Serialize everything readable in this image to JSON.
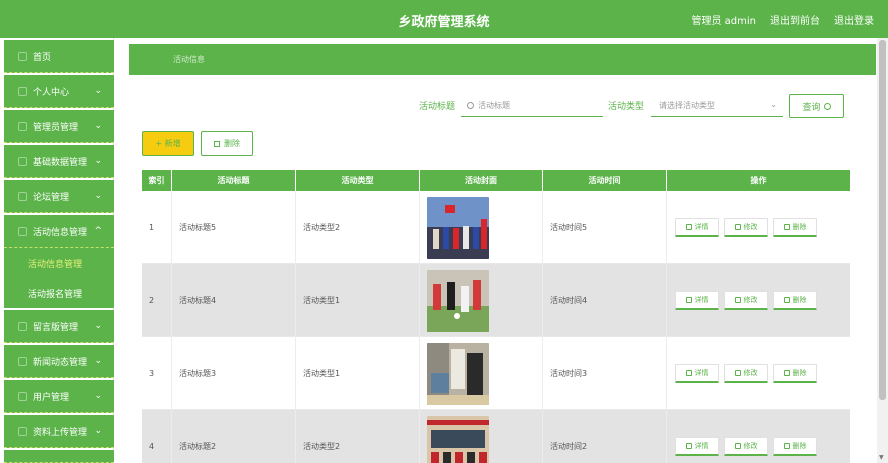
{
  "header": {
    "title": "乡政府管理系统",
    "user_label": "管理员 admin",
    "to_front": "退出到前台",
    "logout": "退出登录"
  },
  "sidebar": {
    "items": [
      {
        "label": "首页"
      },
      {
        "label": "个人中心"
      },
      {
        "label": "管理员管理"
      },
      {
        "label": "基础数据管理"
      },
      {
        "label": "论坛管理"
      },
      {
        "label": "活动信息管理"
      },
      {
        "label": "活动信息管理"
      },
      {
        "label": "活动报名管理"
      },
      {
        "label": "留言版管理"
      },
      {
        "label": "新闻动态管理"
      },
      {
        "label": "用户管理"
      },
      {
        "label": "资料上传管理"
      }
    ]
  },
  "breadcrumb": {
    "current": "活动信息"
  },
  "search": {
    "title_label": "活动标题",
    "title_placeholder": "活动标题",
    "type_label": "活动类型",
    "type_placeholder": "请选择活动类型",
    "query_label": "查询"
  },
  "actions": {
    "add_label": "+ 新增",
    "delete_label": "删除"
  },
  "table": {
    "columns": [
      "索引",
      "活动标题",
      "活动类型",
      "活动封面",
      "活动时间",
      "操作"
    ],
    "rows": [
      {
        "index": "1",
        "title": "活动标题5",
        "type": "活动类型2",
        "time": "活动时间5"
      },
      {
        "index": "2",
        "title": "活动标题4",
        "type": "活动类型1",
        "time": "活动时间4"
      },
      {
        "index": "3",
        "title": "活动标题3",
        "type": "活动类型1",
        "time": "活动时间3"
      },
      {
        "index": "4",
        "title": "活动标题2",
        "type": "活动类型2",
        "time": "活动时间2"
      }
    ],
    "op_detail": "详情",
    "op_edit": "修改",
    "op_delete": "删除"
  },
  "colors": {
    "accent": "#5bb34a",
    "add_button": "#f5cc10"
  }
}
